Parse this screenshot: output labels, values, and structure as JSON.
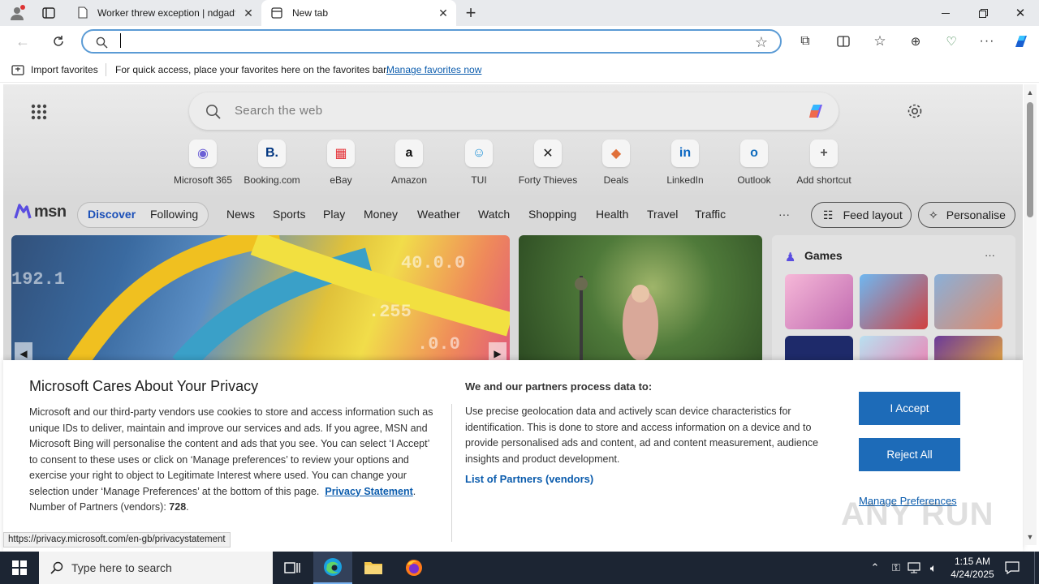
{
  "browser": {
    "tabs": [
      {
        "title": "Worker threw exception | ndgadf",
        "icon": "page-icon"
      },
      {
        "title": "New tab",
        "icon": "newtab-icon"
      }
    ],
    "address": {
      "value": "",
      "placeholder": ""
    },
    "favorites_bar": {
      "import_label": "Import favorites",
      "message": "For quick access, place your favorites here on the favorites bar.",
      "manage_link": "Manage favorites now"
    }
  },
  "newtab": {
    "search_placeholder": "Search the web",
    "shortcuts": [
      {
        "label": "Microsoft 365",
        "glyph": "◉",
        "color": "#6b5fd6"
      },
      {
        "label": "Booking.com",
        "glyph": "B.",
        "color": "#003580"
      },
      {
        "label": "eBay",
        "glyph": "▦",
        "color": "#e53238"
      },
      {
        "label": "Amazon",
        "glyph": "a",
        "color": "#111111"
      },
      {
        "label": "TUI",
        "glyph": "☺",
        "color": "#1a8fd6"
      },
      {
        "label": "Forty Thieves",
        "glyph": "✕",
        "color": "#222222"
      },
      {
        "label": "Deals",
        "glyph": "◆",
        "color": "#e0703a"
      },
      {
        "label": "LinkedIn",
        "glyph": "in",
        "color": "#0a66c2"
      },
      {
        "label": "Outlook",
        "glyph": "o",
        "color": "#0f6cbd"
      },
      {
        "label": "Add shortcut",
        "glyph": "+",
        "color": "#555555"
      }
    ],
    "msn_logo": "msn",
    "nav": [
      "Discover",
      "Following",
      "News",
      "Sports",
      "Play",
      "Money",
      "Weather",
      "Watch",
      "Shopping",
      "Health",
      "Travel",
      "Traffic"
    ],
    "more": "···",
    "feed_layout": "Feed layout",
    "personalise": "Personalise",
    "games": {
      "title": "Games",
      "more": "···"
    }
  },
  "privacy": {
    "title": "Microsoft Cares About Your Privacy",
    "body": "Microsoft and our third-party vendors use cookies to store and access information such as unique IDs to deliver, maintain and improve our services and ads. If you agree, MSN and Microsoft Bing will personalise the content and ads that you see. You can select ‘I Accept’ to consent to these uses or click on ‘Manage preferences’ to review your options and exercise your right to object to Legitimate Interest where used.  You can change your selection under ‘Manage Preferences’ at the bottom of this page.",
    "statement_link": "Privacy Statement",
    "partners_label": "Number of Partners (vendors):",
    "partners_count": "728",
    "process_title": "We and our partners process data to:",
    "process_body": "Use precise geolocation data and actively scan device characteristics for identification. This is done to store and access information on a device and to provide personalised ads and content, ad and content measurement, audience insights and product development.",
    "partners_link": "List of Partners (vendors)",
    "accept": "I Accept",
    "reject": "Reject All",
    "manage": "Manage Preferences"
  },
  "status_url": "https://privacy.microsoft.com/en-gb/privacystatement",
  "watermark": "ANY RUN",
  "taskbar": {
    "search_placeholder": "Type here to search",
    "time": "1:15 AM",
    "date": "4/24/2025"
  }
}
